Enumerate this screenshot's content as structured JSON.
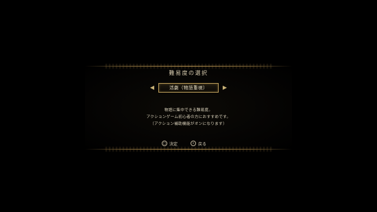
{
  "screen": {
    "title": "難易度の選択"
  },
  "selector": {
    "left_arrow": "◀",
    "right_arrow": "▶",
    "current_option": "活劇（物語重視）"
  },
  "description": {
    "lines": [
      "物語に集中できる難易度。",
      "アクションゲーム初心者の方におすすめです。",
      "（アクション補助機能がオンになります）"
    ]
  },
  "prompts": {
    "confirm": {
      "icon": "◯",
      "label": "決定"
    },
    "back": {
      "icon": "✕",
      "label": "戻る"
    }
  },
  "colors": {
    "background": "#000000",
    "gold_accent": "#b89a58",
    "text": "#e9e2cf"
  }
}
